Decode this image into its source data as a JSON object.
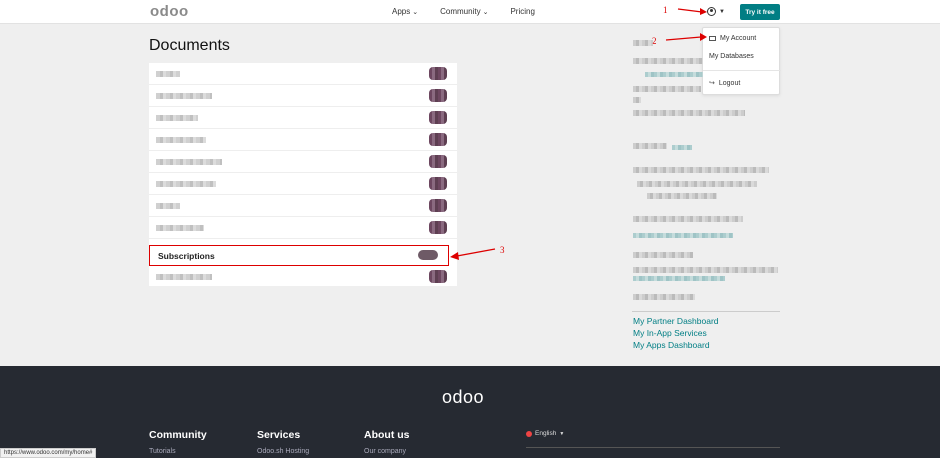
{
  "nav": {
    "logo": "odoo",
    "links": [
      {
        "label": "Apps",
        "has_caret": true
      },
      {
        "label": "Community",
        "has_caret": true
      },
      {
        "label": "Pricing",
        "has_caret": false
      }
    ],
    "try_label": "Try it free"
  },
  "annotations": {
    "one": "1",
    "two": "2",
    "three": "3"
  },
  "dropdown": {
    "my_account": "My Account",
    "my_databases": "My Databases",
    "logout": "Logout"
  },
  "documents": {
    "title": "Documents",
    "highlight_label": "Subscriptions"
  },
  "sidebar": {
    "links": [
      "My Partner Dashboard",
      "My In-App Services",
      "My Apps Dashboard"
    ]
  },
  "footer": {
    "logo": "odoo",
    "columns": [
      {
        "heading": "Community",
        "first": "Tutorials"
      },
      {
        "heading": "Services",
        "first": "Odoo.sh Hosting"
      },
      {
        "heading": "About us",
        "first": "Our company"
      }
    ],
    "language": "English"
  },
  "status_url": "https://www.odoo.com/my/home#",
  "colors": {
    "accent": "#017e84",
    "annotation": "#dd0000",
    "footer_bg": "#262a32"
  }
}
